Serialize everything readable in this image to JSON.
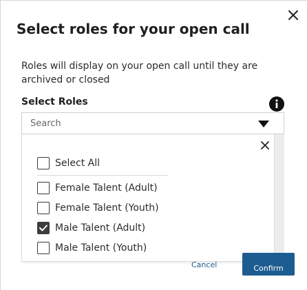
{
  "modal": {
    "title": "Select roles for your open call",
    "description": "Roles will display on your open call until they are archived or closed"
  },
  "roles_field": {
    "label": "Select Roles",
    "search_placeholder": "Search",
    "info_icon": "info-icon",
    "dropdown_icon": "triangle-down-icon"
  },
  "dropdown": {
    "close_icon": "close-icon",
    "select_all": {
      "label": "Select All",
      "checked": false
    },
    "options": [
      {
        "label": "Female Talent (Adult)",
        "checked": false
      },
      {
        "label": "Female Talent (Youth)",
        "checked": false
      },
      {
        "label": "Male Talent (Adult)",
        "checked": true
      },
      {
        "label": "Male Talent (Youth)",
        "checked": false
      }
    ]
  },
  "footer": {
    "cancel_label": "Cancel",
    "confirm_label": "Confirm"
  },
  "colors": {
    "primary": "#1d5c91",
    "link": "#1e5a8c",
    "checked": "#3d3d3d"
  }
}
